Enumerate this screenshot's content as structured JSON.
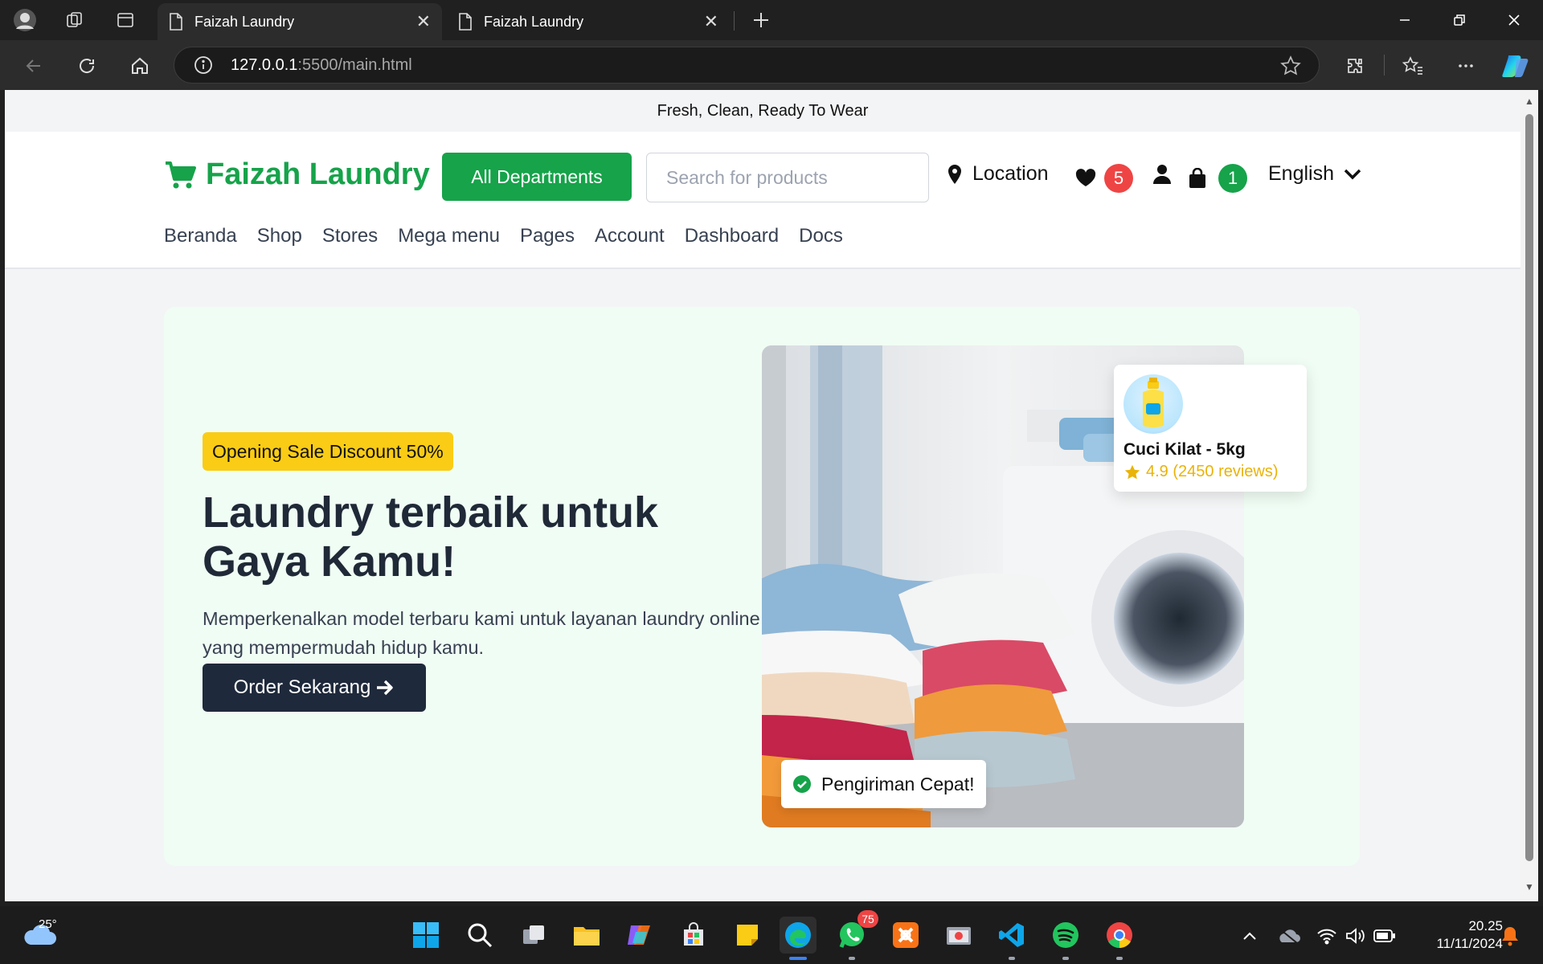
{
  "browser": {
    "tabs": [
      {
        "title": "Faizah Laundry",
        "active": true
      },
      {
        "title": "Faizah Laundry",
        "active": false
      }
    ],
    "url_host": "127.0.0.1",
    "url_rest": ":5500/main.html"
  },
  "page": {
    "announcement": "Fresh, Clean, Ready To Wear",
    "brand": "Faizah Laundry",
    "departments_label": "All Departments",
    "search_placeholder": "Search for products",
    "location_label": "Location",
    "wishlist_count": "5",
    "cart_count": "1",
    "language": "English",
    "menu": [
      "Beranda",
      "Shop",
      "Stores",
      "Mega menu",
      "Pages",
      "Account",
      "Dashboard",
      "Docs"
    ],
    "hero": {
      "badge": "Opening Sale Discount 50%",
      "headline": "Laundry terbaik untuk Gaya Kamu!",
      "subtext": "Memperkenalkan model terbaru kami untuk layanan laundry online yang mempermudah hidup kamu.",
      "cta": "Order Sekarang",
      "product_name": "Cuci Kilat - 5kg",
      "product_rating": "4.9 (2450 reviews)",
      "shipping_label": "Pengiriman Cepat!"
    }
  },
  "taskbar": {
    "temperature": "25°",
    "whatsapp_badge": "75",
    "time": "20.25",
    "date": "11/11/2024"
  },
  "colors": {
    "brand_green": "#16a34a",
    "promo_yellow": "#facc15",
    "hero_bg": "#f0fdf4",
    "cta_dark": "#1e293b",
    "badge_red": "#ef4444"
  }
}
